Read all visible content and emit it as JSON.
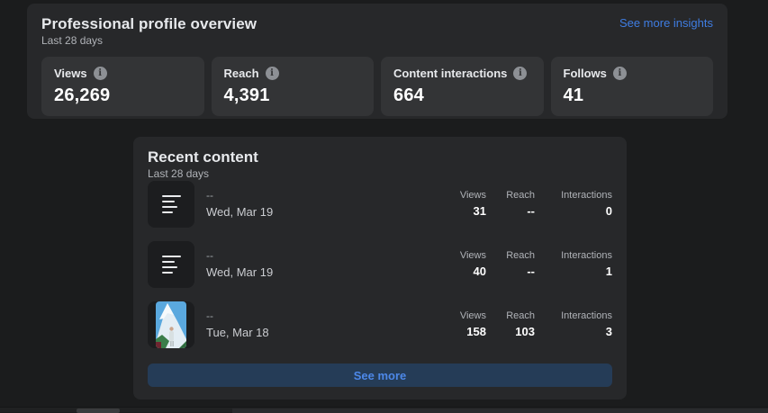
{
  "overview": {
    "title": "Professional profile overview",
    "subtitle": "Last 28 days",
    "see_more_insights_label": "See more insights",
    "stats": [
      {
        "label": "Views",
        "value": "26,269"
      },
      {
        "label": "Reach",
        "value": "4,391"
      },
      {
        "label": "Content interactions",
        "value": "664"
      },
      {
        "label": "Follows",
        "value": "41"
      }
    ]
  },
  "recent": {
    "title": "Recent content",
    "subtitle": "Last 28 days",
    "columns": {
      "views": "Views",
      "reach": "Reach",
      "interactions": "Interactions"
    },
    "items": [
      {
        "title": "--",
        "date": "Wed, Mar 19",
        "views": "31",
        "reach": "--",
        "interactions": "0"
      },
      {
        "title": "--",
        "date": "Wed, Mar 19",
        "views": "40",
        "reach": "--",
        "interactions": "1"
      },
      {
        "title": "--",
        "date": "Tue, Mar 18",
        "views": "158",
        "reach": "103",
        "interactions": "3"
      }
    ],
    "see_more_label": "See more"
  },
  "icons": {
    "info_glyph": "i"
  },
  "colors": {
    "page_bg": "#1b1c1d",
    "card_bg": "#27282a",
    "tile_bg": "#333436",
    "link_blue": "#3f7de2",
    "button_bg": "#253c57",
    "button_text": "#4d88e8"
  }
}
